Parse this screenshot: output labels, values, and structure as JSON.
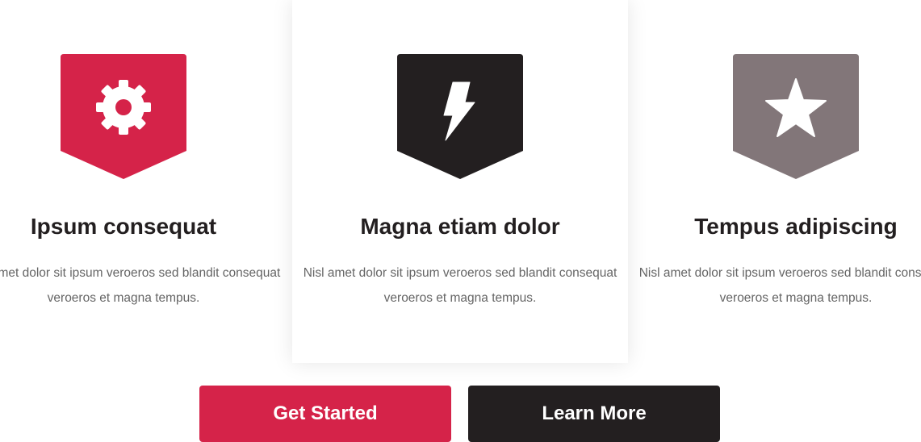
{
  "features": [
    {
      "title": "Ipsum consequat",
      "text": "Nisl amet dolor sit ipsum veroeros sed blandit consequat veroeros et magna tempus.",
      "icon": "gear-icon",
      "color": "#d52349"
    },
    {
      "title": "Magna etiam dolor",
      "text": "Nisl amet dolor sit ipsum veroeros sed blandit consequat veroeros et magna tempus.",
      "icon": "bolt-icon",
      "color": "#231f20"
    },
    {
      "title": "Tempus adipiscing",
      "text": "Nisl amet dolor sit ipsum veroeros sed blandit consequat veroeros et magna tempus.",
      "icon": "star-icon",
      "color": "#827679"
    }
  ],
  "actions": {
    "get_started": "Get Started",
    "learn_more": "Learn More"
  },
  "colors": {
    "accent": "#d52349",
    "dark": "#231f20",
    "muted": "#827679"
  }
}
